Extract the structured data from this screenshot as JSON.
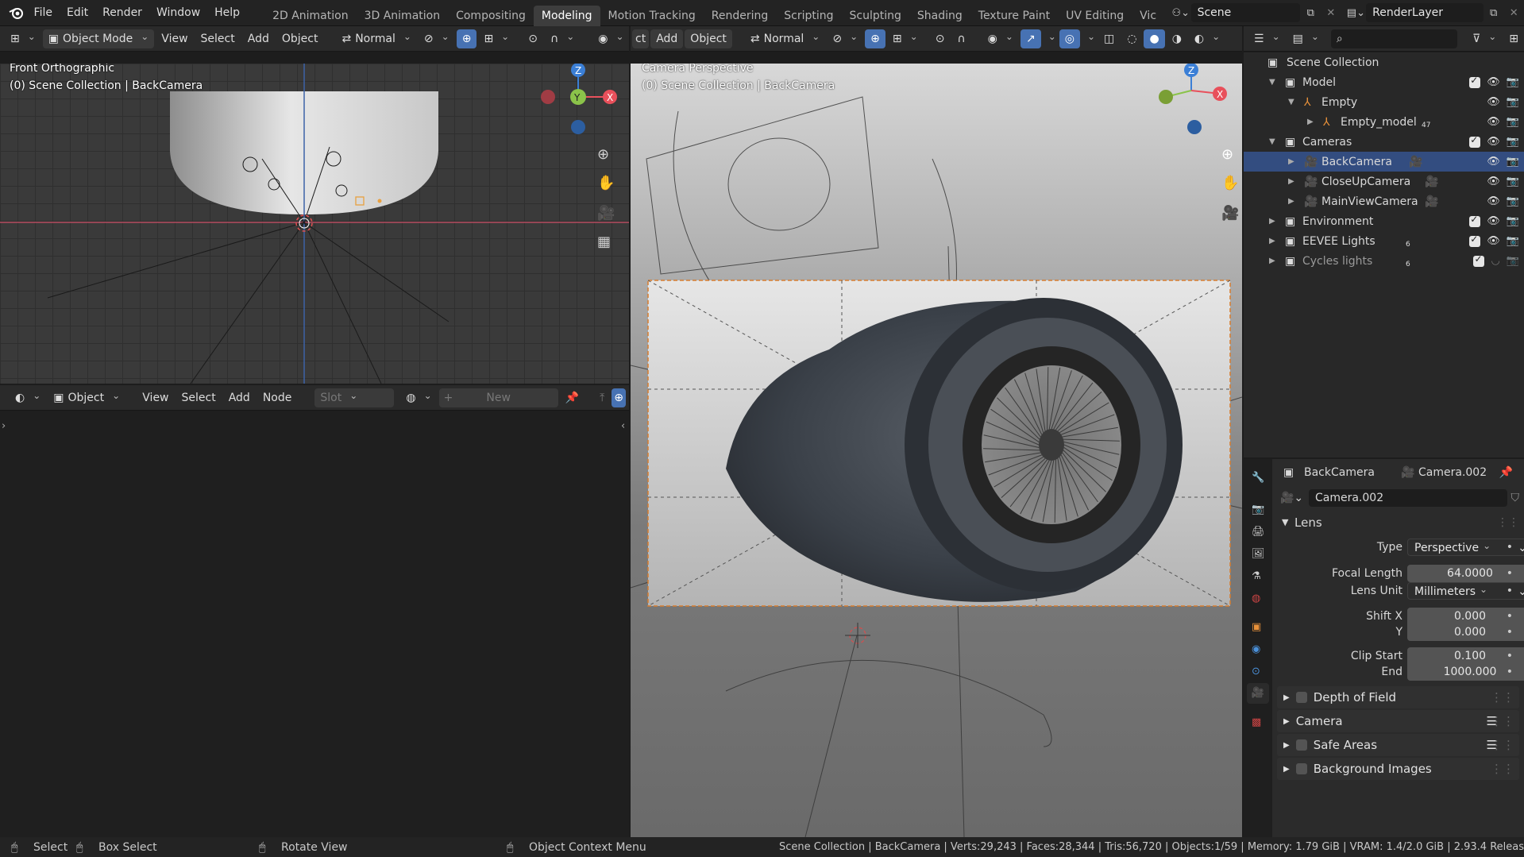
{
  "topbar": {
    "menus": [
      "File",
      "Edit",
      "Render",
      "Window",
      "Help"
    ],
    "workspaces": [
      "2D Animation",
      "3D Animation",
      "Compositing",
      "Modeling",
      "Motion Tracking",
      "Rendering",
      "Scripting",
      "Sculpting",
      "Shading",
      "Texture Paint",
      "UV Editing",
      "Vic"
    ],
    "active_workspace": "Modeling",
    "scene": "Scene",
    "view_layer": "RenderLayer"
  },
  "left_viewport": {
    "header": {
      "mode": "Object Mode",
      "menus": [
        "View",
        "Select",
        "Add",
        "Object"
      ],
      "orientation": "Normal"
    },
    "view_name": "Front Orthographic",
    "collection_info": "(0) Scene Collection | BackCamera"
  },
  "right_viewport": {
    "header": {
      "menus_partial": "ct",
      "menus": [
        "Add",
        "Object"
      ],
      "orientation": "Normal"
    },
    "view_name": "Camera Perspective",
    "collection_info": "(0) Scene Collection | BackCamera"
  },
  "node_editor": {
    "header": {
      "object_label": "Object",
      "menus": [
        "View",
        "Select",
        "Add",
        "Node"
      ],
      "slot": "Slot",
      "new_label": "New"
    }
  },
  "outliner": {
    "title": "Scene Collection",
    "items": [
      {
        "label": "Model",
        "kind": "collection",
        "depth": 1
      },
      {
        "label": "Empty",
        "kind": "empty",
        "depth": 2
      },
      {
        "label": "Empty_model",
        "kind": "empty",
        "depth": 3,
        "badge": "47"
      },
      {
        "label": "Cameras",
        "kind": "collection",
        "depth": 1
      },
      {
        "label": "BackCamera",
        "kind": "camera",
        "depth": 2,
        "selected": true
      },
      {
        "label": "CloseUpCamera",
        "kind": "camera",
        "depth": 2
      },
      {
        "label": "MainViewCamera",
        "kind": "camera",
        "depth": 2
      },
      {
        "label": "Environment",
        "kind": "collection",
        "depth": 1
      },
      {
        "label": "EEVEE Lights",
        "kind": "collection",
        "depth": 1,
        "badge": "6"
      },
      {
        "label": "Cycles lights",
        "kind": "collection",
        "depth": 1,
        "badge": "6",
        "disabled": true
      }
    ]
  },
  "properties": {
    "breadcrumb_object": "BackCamera",
    "breadcrumb_data": "Camera.002",
    "datablock": "Camera.002",
    "lens_panel": "Lens",
    "type_label": "Type",
    "type_value": "Perspective",
    "focal_label": "Focal Length",
    "focal_value": "64.0000",
    "unit_label": "Lens Unit",
    "unit_value": "Millimeters",
    "shiftx_label": "Shift X",
    "shiftx_value": "0.000",
    "shifty_label": "Y",
    "shifty_value": "0.000",
    "clipstart_label": "Clip Start",
    "clipstart_value": "0.100",
    "clipend_label": "End",
    "clipend_value": "1000.000",
    "panels": [
      "Depth of Field",
      "Camera",
      "Safe Areas",
      "Background Images"
    ]
  },
  "statusbar": {
    "select": "Select",
    "box_select": "Box Select",
    "rotate": "Rotate View",
    "context_menu": "Object Context Menu",
    "stats": "Scene Collection | BackCamera | Verts:29,243 | Faces:28,344 | Tris:56,720 | Objects:1/59 | Memory: 1.79 GiB | VRAM: 1.4/2.0 GiB | 2.93.4 Releas"
  },
  "colors": {
    "accent": "#4772b3",
    "selected_row": "#334d80",
    "x_axis": "#e8505b",
    "y_axis": "#8bc34a",
    "z_axis": "#3b7fd6",
    "camera_icon": "#e87d3e"
  }
}
